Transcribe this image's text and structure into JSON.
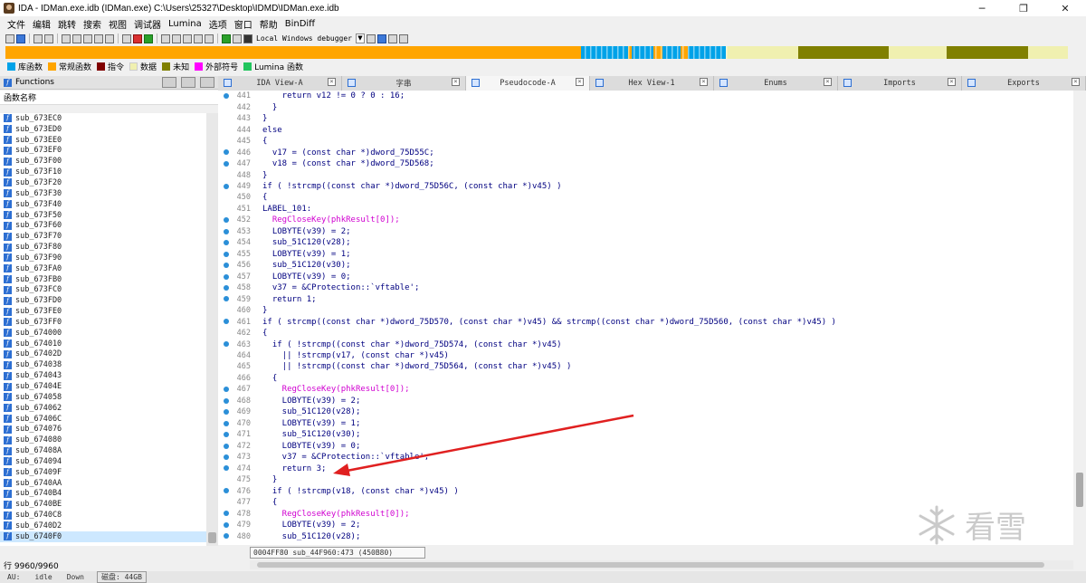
{
  "window": {
    "title": "IDA - IDMan.exe.idb (IDMan.exe) C:\\Users\\25327\\Desktop\\IDMD\\IDMan.exe.idb",
    "minimize": "─",
    "restore": "❐",
    "close": "✕"
  },
  "menu": [
    "文件",
    "编辑",
    "跳转",
    "搜索",
    "视图",
    "调试器",
    "Lumina",
    "选项",
    "窗口",
    "帮助",
    "BinDiff"
  ],
  "toolbar": {
    "debugger_label": "Local Windows debugger"
  },
  "legend": [
    {
      "label": "库函数",
      "color": "#00a2e8"
    },
    {
      "label": "常规函数",
      "color": "#ffa500"
    },
    {
      "label": "指令",
      "color": "#800000"
    },
    {
      "label": "数据",
      "color": "#f0f0b0"
    },
    {
      "label": "未知",
      "color": "#808000"
    },
    {
      "label": "外部符号",
      "color": "#ff00ff"
    },
    {
      "label": "Lumina 函数",
      "color": "#22c55e"
    }
  ],
  "functions_panel": {
    "title": "Functions",
    "column_header": "函数名称",
    "items": [
      "sub_673EC0",
      "sub_673ED0",
      "sub_673EE0",
      "sub_673EF0",
      "sub_673F00",
      "sub_673F10",
      "sub_673F20",
      "sub_673F30",
      "sub_673F40",
      "sub_673F50",
      "sub_673F60",
      "sub_673F70",
      "sub_673F80",
      "sub_673F90",
      "sub_673FA0",
      "sub_673FB0",
      "sub_673FC0",
      "sub_673FD0",
      "sub_673FE0",
      "sub_673FF0",
      "sub_674000",
      "sub_674010",
      "sub_67402D",
      "sub_674038",
      "sub_674043",
      "sub_67404E",
      "sub_674058",
      "sub_674062",
      "sub_67406C",
      "sub_674076",
      "sub_674080",
      "sub_67408A",
      "sub_674094",
      "sub_67409F",
      "sub_6740AA",
      "sub_6740B4",
      "sub_6740BE",
      "sub_6740C8",
      "sub_6740D2",
      "sub_6740F0"
    ],
    "row_count": "行 9960/9960"
  },
  "tabs": [
    {
      "label": "IDA View-A"
    },
    {
      "label": "字串"
    },
    {
      "label": "Pseudocode-A"
    },
    {
      "label": "Hex View-1"
    },
    {
      "label": "Enums"
    },
    {
      "label": "Imports"
    },
    {
      "label": "Exports"
    }
  ],
  "code_lines": [
    {
      "n": "441",
      "dot": true,
      "t": "    return v12 != 0 ? 0 : 16;"
    },
    {
      "n": "442",
      "dot": false,
      "t": "  }"
    },
    {
      "n": "443",
      "dot": false,
      "t": "}"
    },
    {
      "n": "444",
      "dot": false,
      "t": "else"
    },
    {
      "n": "445",
      "dot": false,
      "t": "{"
    },
    {
      "n": "446",
      "dot": true,
      "t": "  v17 = (const char *)dword_75D55C;"
    },
    {
      "n": "447",
      "dot": true,
      "t": "  v18 = (const char *)dword_75D568;"
    },
    {
      "n": "448",
      "dot": false,
      "t": "}"
    },
    {
      "n": "449",
      "dot": true,
      "t": "if ( !strcmp((const char *)dword_75D56C, (const char *)v45) )"
    },
    {
      "n": "450",
      "dot": false,
      "t": "{"
    },
    {
      "n": "451",
      "dot": false,
      "t": "LABEL_101:"
    },
    {
      "n": "452",
      "dot": true,
      "t": "  RegCloseKey(phkResult[0]);"
    },
    {
      "n": "453",
      "dot": true,
      "t": "  LOBYTE(v39) = 2;"
    },
    {
      "n": "454",
      "dot": true,
      "t": "  sub_51C120(v28);"
    },
    {
      "n": "455",
      "dot": true,
      "t": "  LOBYTE(v39) = 1;"
    },
    {
      "n": "456",
      "dot": true,
      "t": "  sub_51C120(v30);"
    },
    {
      "n": "457",
      "dot": true,
      "t": "  LOBYTE(v39) = 0;"
    },
    {
      "n": "458",
      "dot": true,
      "t": "  v37 = &CProtection::`vftable';"
    },
    {
      "n": "459",
      "dot": true,
      "t": "  return 1;"
    },
    {
      "n": "460",
      "dot": false,
      "t": "}"
    },
    {
      "n": "461",
      "dot": true,
      "t": "if ( strcmp((const char *)dword_75D570, (const char *)v45) && strcmp((const char *)dword_75D560, (const char *)v45) )"
    },
    {
      "n": "462",
      "dot": false,
      "t": "{"
    },
    {
      "n": "463",
      "dot": true,
      "t": "  if ( !strcmp((const char *)dword_75D574, (const char *)v45)"
    },
    {
      "n": "464",
      "dot": false,
      "t": "    || !strcmp(v17, (const char *)v45)"
    },
    {
      "n": "465",
      "dot": false,
      "t": "    || !strcmp((const char *)dword_75D564, (const char *)v45) )"
    },
    {
      "n": "466",
      "dot": false,
      "t": "  {"
    },
    {
      "n": "467",
      "dot": true,
      "t": "    RegCloseKey(phkResult[0]);"
    },
    {
      "n": "468",
      "dot": true,
      "t": "    LOBYTE(v39) = 2;"
    },
    {
      "n": "469",
      "dot": true,
      "t": "    sub_51C120(v28);"
    },
    {
      "n": "470",
      "dot": true,
      "t": "    LOBYTE(v39) = 1;"
    },
    {
      "n": "471",
      "dot": true,
      "t": "    sub_51C120(v30);"
    },
    {
      "n": "472",
      "dot": true,
      "t": "    LOBYTE(v39) = 0;"
    },
    {
      "n": "473",
      "dot": true,
      "t": "    v37 = &CProtection::`vftable';"
    },
    {
      "n": "474",
      "dot": true,
      "t": "    return 3;"
    },
    {
      "n": "475",
      "dot": false,
      "t": "  }"
    },
    {
      "n": "476",
      "dot": true,
      "t": "  if ( !strcmp(v18, (const char *)v45) )"
    },
    {
      "n": "477",
      "dot": false,
      "t": "  {"
    },
    {
      "n": "478",
      "dot": true,
      "t": "    RegCloseKey(phkResult[0]);"
    },
    {
      "n": "479",
      "dot": true,
      "t": "    LOBYTE(v39) = 2;"
    },
    {
      "n": "480",
      "dot": true,
      "t": "    sub_51C120(v28);"
    }
  ],
  "code_footer": "0004FF80 sub_44F960:473 (450B80)",
  "statusbar": {
    "au": "AU:",
    "state": "idle",
    "direction": "Down",
    "disk": "磁盘: 44GB"
  },
  "watermark": "看雪"
}
